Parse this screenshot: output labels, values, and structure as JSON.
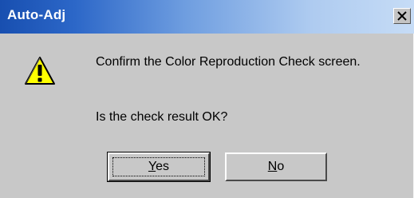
{
  "window": {
    "title": "Auto-Adj",
    "close_icon": "close-icon"
  },
  "message": {
    "icon": "warning-icon",
    "line1": "Confirm the Color Reproduction Check screen.",
    "line2": "Is the check result OK?"
  },
  "buttons": {
    "yes": {
      "mnemonic": "Y",
      "rest": "es",
      "focused": true
    },
    "no": {
      "mnemonic": "N",
      "rest": "o",
      "focused": false
    }
  },
  "colors": {
    "title_bar_start": "#184fb0",
    "title_bar_end": "#c6dcf6",
    "dialog_face": "#c8c8c8",
    "warning_fill": "#ffff00"
  }
}
